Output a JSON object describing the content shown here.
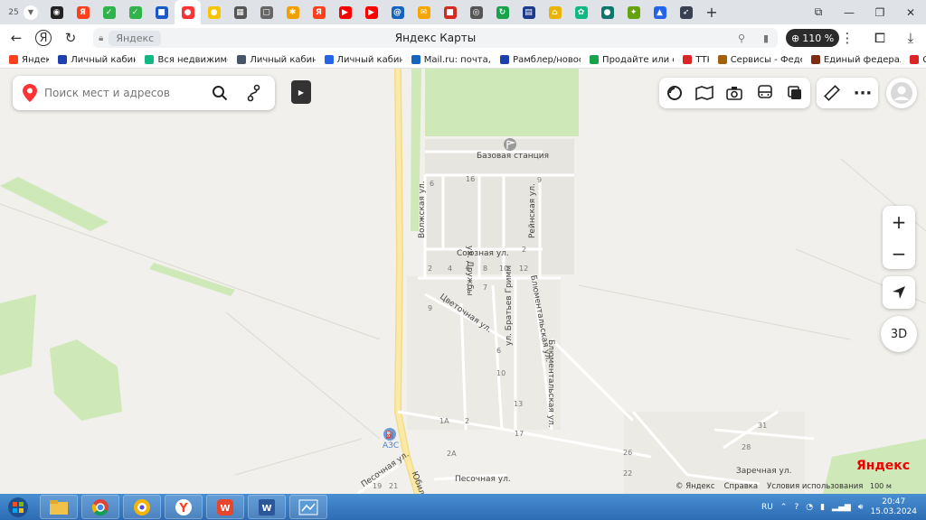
{
  "browser": {
    "tab_count": "25",
    "tabs": [
      {
        "icon": "black-circle-icon",
        "color": "#222222",
        "glyph": "◉"
      },
      {
        "icon": "yandex-icon",
        "color": "#fc3f1d",
        "glyph": "Я"
      },
      {
        "icon": "green-check-icon",
        "color": "#2fb34a",
        "glyph": "✓"
      },
      {
        "icon": "green-check-icon",
        "color": "#2fb34a",
        "glyph": "✓"
      },
      {
        "icon": "russia-flag-icon",
        "color": "#1a5ac8",
        "glyph": "■"
      },
      {
        "icon": "map-pin-icon",
        "color": "#f33",
        "glyph": "●",
        "active": true
      },
      {
        "icon": "beeline-icon",
        "color": "#f8c400",
        "glyph": "●"
      },
      {
        "icon": "building-icon",
        "color": "#555555",
        "glyph": "▦"
      },
      {
        "icon": "document-icon",
        "color": "#666666",
        "glyph": "▢"
      },
      {
        "icon": "star-icon",
        "color": "#f0a000",
        "glyph": "✱"
      },
      {
        "icon": "yandex-icon",
        "color": "#fc3f1d",
        "glyph": "Я"
      },
      {
        "icon": "youtube-icon",
        "color": "#ff0000",
        "glyph": "▶"
      },
      {
        "icon": "youtube-icon",
        "color": "#ff0000",
        "glyph": "▶"
      },
      {
        "icon": "at-icon",
        "color": "#1565c0",
        "glyph": "@"
      },
      {
        "icon": "mail-icon",
        "color": "#f7a600",
        "glyph": "✉"
      },
      {
        "icon": "russia-flag-icon",
        "color": "#d52b1e",
        "glyph": "■"
      },
      {
        "icon": "gosuslugi-icon",
        "color": "#555555",
        "glyph": "◎"
      },
      {
        "icon": "refresh-green-icon",
        "color": "#16a34a",
        "glyph": "↻"
      },
      {
        "icon": "chart-icon",
        "color": "#1e3a8a",
        "glyph": "▤"
      },
      {
        "icon": "home-icon",
        "color": "#eab308",
        "glyph": "⌂"
      },
      {
        "icon": "apps-icon",
        "color": "#10b981",
        "glyph": "✿"
      },
      {
        "icon": "sbis-icon",
        "color": "#0f766e",
        "glyph": "●"
      },
      {
        "icon": "leaf-icon",
        "color": "#65a30d",
        "glyph": "✦"
      },
      {
        "icon": "mountain-icon",
        "color": "#2563eb",
        "glyph": "▲"
      },
      {
        "icon": "rocket-icon",
        "color": "#374151",
        "glyph": "➶"
      }
    ],
    "url_host": "Яндекс",
    "page_title": "Яндекс Карты",
    "zoom": "110 %",
    "bookmarks": [
      {
        "label": "Яндекс",
        "icon": "yandex-icon",
        "color": "#fc3f1d"
      },
      {
        "label": "Личный кабинет",
        "icon": "slash-icon",
        "color": "#1e40af"
      },
      {
        "label": "Вся недвижимост",
        "icon": "apps-icon",
        "color": "#10b981"
      },
      {
        "label": "Личный кабинет",
        "icon": "home-icon",
        "color": "#475569"
      },
      {
        "label": "Личный кабинет",
        "icon": "mountain-icon",
        "color": "#2563eb"
      },
      {
        "label": "Mail.ru: почта, по",
        "icon": "at-icon",
        "color": "#1565c0"
      },
      {
        "label": "Рамблер/новости",
        "icon": "slash-icon",
        "color": "#1e40af"
      },
      {
        "label": "Продайте или сда",
        "icon": "refresh-green-icon",
        "color": "#16a34a"
      },
      {
        "label": "ТТК",
        "icon": "ttk-icon",
        "color": "#dc2626"
      },
      {
        "label": "Сервисы - Федера",
        "icon": "emblem-icon",
        "color": "#a16207"
      },
      {
        "label": "Единый федеральн",
        "icon": "emblem-icon",
        "color": "#7c2d12"
      },
      {
        "label": "С",
        "icon": "gosuslugi-icon",
        "color": "#dc2626"
      }
    ]
  },
  "map": {
    "search_placeholder": "Поиск мест и адресов",
    "zoom_in": "+",
    "zoom_out": "−",
    "btn_3d": "3D",
    "logo_main": "Яндекс",
    "scale": "100 м",
    "copyright": [
      "© Яндекс",
      "Справка",
      "Условия использования"
    ],
    "labels": {
      "base_station": "Базовая станция",
      "volzhskaya": "Волжская ул.",
      "druzhby": "ул. Дружбы",
      "reynskaya": "Рейнская ул.",
      "soyuznaya": "Союзная ул.",
      "bratyev_grimm": "ул. Братьев Гримм",
      "blumental_1": "Блюментальская ул.",
      "blumental_2": "Блюментальская ул.",
      "tsvetochnaya": "Цветочная ул.",
      "azs": "АЗС",
      "pesochnaya_1": "Песочная ул.",
      "pesochnaya_2": "Песочная ул.",
      "yubileynaya": "Юбил",
      "zarechnaya": "Заречная ул."
    },
    "house_numbers": [
      "6",
      "16",
      "9",
      "2",
      "2",
      "4",
      "6",
      "8",
      "10",
      "12",
      "1",
      "7",
      "9",
      "6",
      "10",
      "13",
      "1А",
      "2",
      "17",
      "2А",
      "26",
      "22",
      "31",
      "28",
      "21",
      "19"
    ]
  },
  "taskbar": {
    "lang": "RU",
    "time": "20:47",
    "date": "15.03.2024"
  }
}
